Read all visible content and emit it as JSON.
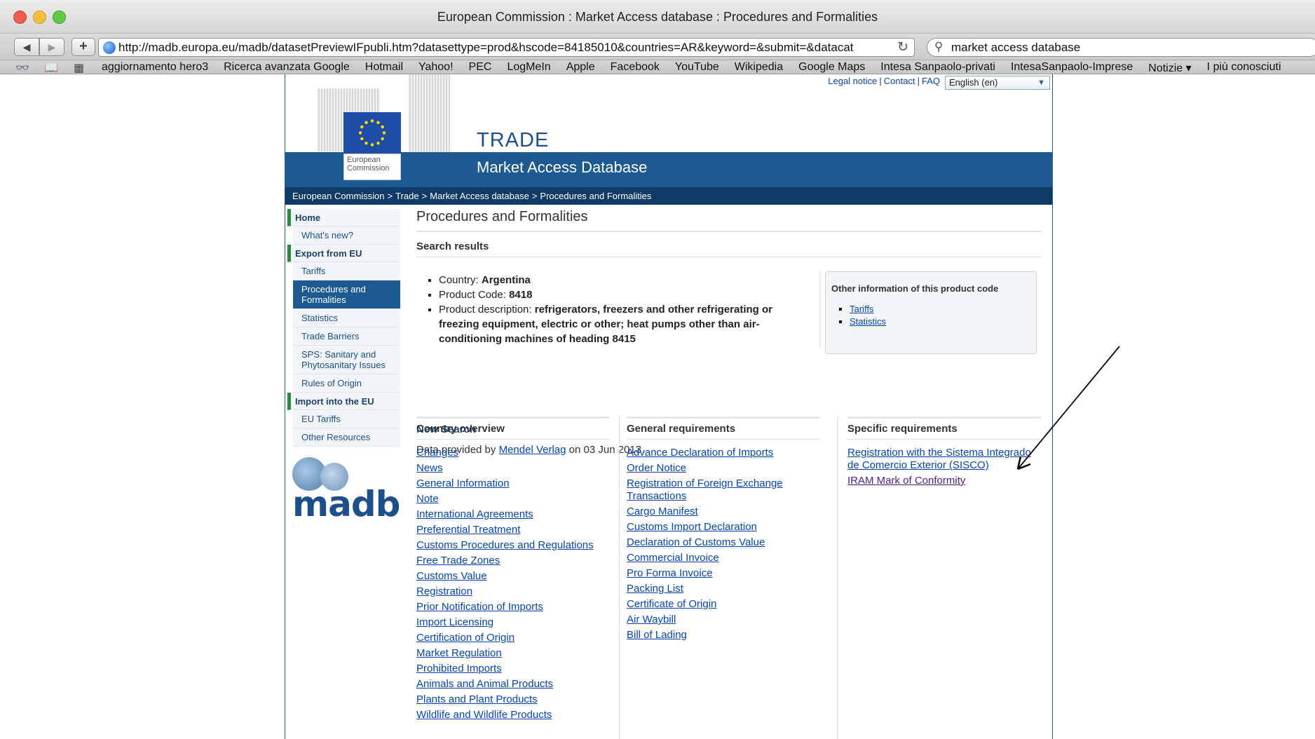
{
  "browser": {
    "window_title": "European Commission : Market Access database : Procedures and Formalities",
    "url": "http://madb.europa.eu/madb/datasetPreviewIFpubli.htm?datasettype=prod&hscode=84185010&countries=AR&keyword=&submit=&datacat",
    "search_query": "market access database",
    "bookmarks": [
      "aggiornamento hero3",
      "Ricerca avanzata Google",
      "Hotmail",
      "Yahoo!",
      "PEC",
      "LogMeIn",
      "Apple",
      "Facebook",
      "YouTube",
      "Wikipedia",
      "Google Maps",
      "Intesa Sanpaolo-privati",
      "IntesaSanpaolo-Imprese",
      "Notizie ▾",
      "I più conosciuti"
    ]
  },
  "header": {
    "legal_notice": "Legal notice",
    "contact": "Contact",
    "faq": "FAQ",
    "language": "English (en)",
    "ec_label_1": "European",
    "ec_label_2": "Commission",
    "trade": "TRADE",
    "madb_title": "Market Access Database"
  },
  "breadcrumb": [
    "European Commission",
    "Trade",
    "Market Access database",
    "Procedures and Formalities"
  ],
  "sidebar": {
    "items": [
      {
        "label": "Home",
        "type": "section"
      },
      {
        "label": "What's new?",
        "type": "sub"
      },
      {
        "label": "Export from EU",
        "type": "section"
      },
      {
        "label": "Tariffs",
        "type": "sub"
      },
      {
        "label": "Procedures and Formalities",
        "type": "sub",
        "active": true
      },
      {
        "label": "Statistics",
        "type": "sub"
      },
      {
        "label": "Trade Barriers",
        "type": "sub"
      },
      {
        "label": "SPS: Sanitary and Phytosanitary Issues",
        "type": "sub"
      },
      {
        "label": "Rules of Origin",
        "type": "sub"
      },
      {
        "label": "Import into the EU",
        "type": "section"
      },
      {
        "label": "EU Tariffs",
        "type": "sub"
      },
      {
        "label": "Other Resources",
        "type": "sub"
      }
    ],
    "logo_text": "madb"
  },
  "main": {
    "page_title": "Procedures and Formalities",
    "search_results_title": "Search results",
    "country_label": "Country:",
    "country_value": "Argentina",
    "product_code_label": "Product Code:",
    "product_code_value": "8418",
    "product_desc_label": "Product description:",
    "product_desc_value": "refrigerators, freezers and other refrigerating or freezing equipment, electric or other; heat pumps other than air-conditioning machines of heading 8415",
    "other_info_title": "Other information of this product code",
    "other_info_links": [
      "Tariffs",
      "Statistics"
    ],
    "new_search": "New Search",
    "data_provided_prefix": "Data provided by",
    "data_provider": "Mendel Verlag",
    "data_provided_suffix": "on 03 Jun 2013"
  },
  "columns": {
    "country_overview": {
      "title": "Country overview",
      "links": [
        "Changes",
        "News",
        "General Information",
        "Note",
        "International Agreements",
        "Preferential Treatment",
        "Customs Procedures and Regulations",
        "Free Trade Zones",
        "Customs Value",
        "Registration",
        "Prior Notification of Imports",
        "Import Licensing",
        "Certification of Origin",
        "Market Regulation",
        "Prohibited Imports",
        "Animals and Animal Products",
        "Plants and Plant Products",
        "Wildlife and Wildlife Products"
      ]
    },
    "general_requirements": {
      "title": "General requirements",
      "links": [
        "Advance Declaration of Imports",
        "Order Notice",
        "Registration of Foreign Exchange Transactions",
        "Cargo Manifest",
        "Customs Import Declaration",
        "Declaration of Customs Value",
        "Commercial Invoice",
        "Pro Forma Invoice",
        "Packing List",
        "Certificate of Origin",
        "Air Waybill",
        "Bill of Lading"
      ]
    },
    "specific_requirements": {
      "title": "Specific requirements",
      "links": [
        "Registration with the Sistema Integrado de Comercio Exterior (SISCO)",
        "IRAM Mark of Conformity"
      ]
    }
  },
  "colors": {
    "eu_blue": "#1d5a92",
    "breadcrumb_bg": "#0f3b66",
    "link": "#0645ad",
    "visited": "#551a8b",
    "section_marker": "#2c8a3a"
  }
}
